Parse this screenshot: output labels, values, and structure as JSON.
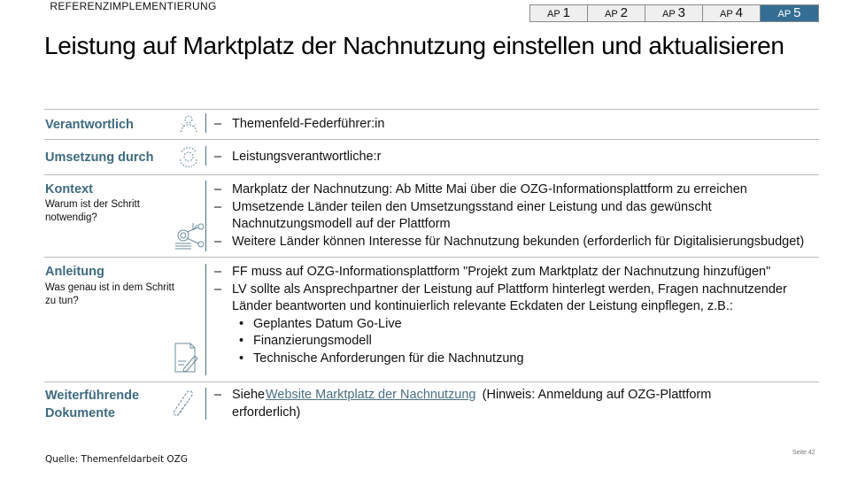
{
  "header": {
    "section_tag": "REFERENZIMPLEMENTIERUNG",
    "title": "Leistung auf Marktplatz der Nachnutzung einstellen und aktualisieren",
    "ap_tabs": [
      {
        "prefix": "AP",
        "num": "1",
        "active": false
      },
      {
        "prefix": "AP",
        "num": "2",
        "active": false
      },
      {
        "prefix": "AP",
        "num": "3",
        "active": false
      },
      {
        "prefix": "AP",
        "num": "4",
        "active": false
      },
      {
        "prefix": "AP",
        "num": "5",
        "active": true
      }
    ],
    "active_color": "#356e94"
  },
  "rows": {
    "verantwortlich": {
      "label": "Verantwortlich",
      "icon": "person-icon",
      "items": [
        "Themenfeld-Federführer:in"
      ]
    },
    "umsetzung": {
      "label": "Umsetzung durch",
      "icon": "group-icon",
      "items": [
        "Leistungsverantwortliche:r"
      ]
    },
    "kontext": {
      "label": "Kontext",
      "sublabel": "Warum ist der Schritt notwendig?",
      "icon": "network-analysis-icon",
      "items": [
        "Markplatz der Nachnutzung: Ab Mitte Mai über die OZG-Informationsplattform zu erreichen",
        "Umsetzende Länder teilen den Umsetzungsstand einer Leistung und das gewünscht Nachnutzungsmodell auf der Plattform",
        "Weitere Länder können Interesse für Nachnutzung bekunden (erforderlich für Digitalisierungsbudget)"
      ]
    },
    "anleitung": {
      "label": "Anleitung",
      "sublabel": "Was genau ist in dem Schritt zu tun?",
      "icon": "document-edit-icon",
      "items": [
        "FF muss auf OZG-Informationsplattform \"Projekt zum Marktplatz der Nachnutzung hinzufügen\"",
        "LV sollte als Ansprechpartner der Leistung auf Plattform hinterlegt werden, Fragen nachnutzender Länder beantworten und kontinuierlich relevante Eckdaten der Leistung einpflegen, z.B.:"
      ],
      "sub_items": [
        "Geplantes Datum Go-Live",
        "Finanzierungsmodell",
        "Technische Anforderungen für die Nachnutzung"
      ]
    },
    "dokumente": {
      "label": "Weiterführende Dokumente",
      "icon": "paperclip-icon",
      "prefix": "Siehe ",
      "link_text": "Website Marktplatz der Nachnutzung",
      "suffix": " (Hinweis: Anmeldung auf OZG-Plattform erforderlich)"
    }
  },
  "footer": {
    "source": "Quelle: Themenfeldarbeit OZG",
    "page": "Seite 42"
  }
}
